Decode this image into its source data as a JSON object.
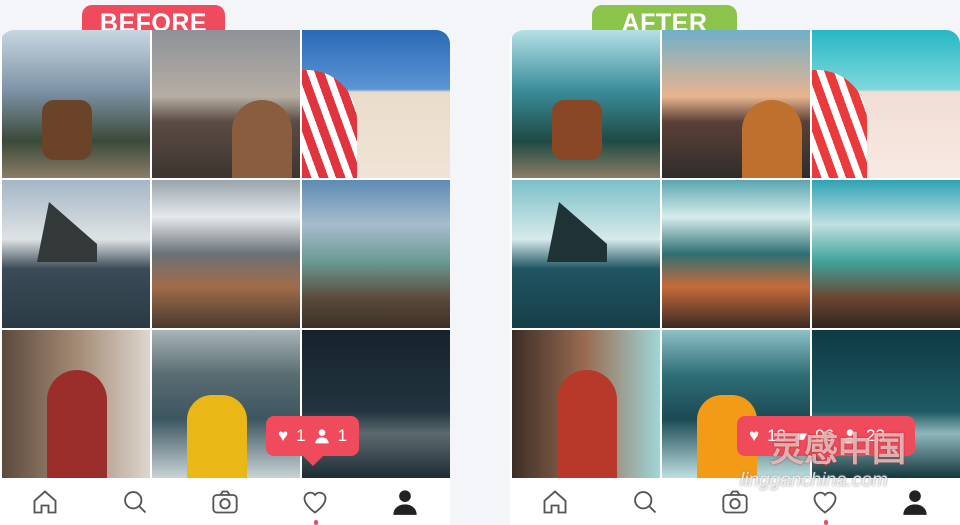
{
  "labels": {
    "before": "BEFORE",
    "after": "AFTER"
  },
  "colors": {
    "before_badge": "#ef4b5c",
    "after_badge": "#8cc34b",
    "notification": "#ef4b5c"
  },
  "before": {
    "notification": {
      "likes": "1",
      "followers": "1"
    }
  },
  "after": {
    "notification": {
      "likes": "18",
      "comments": "96",
      "followers": "23"
    }
  },
  "nav_icons": [
    "home-icon",
    "search-icon",
    "camera-icon",
    "heart-icon",
    "profile-icon"
  ],
  "watermark": {
    "text": "灵感中国",
    "url": "lingganchina.com"
  }
}
